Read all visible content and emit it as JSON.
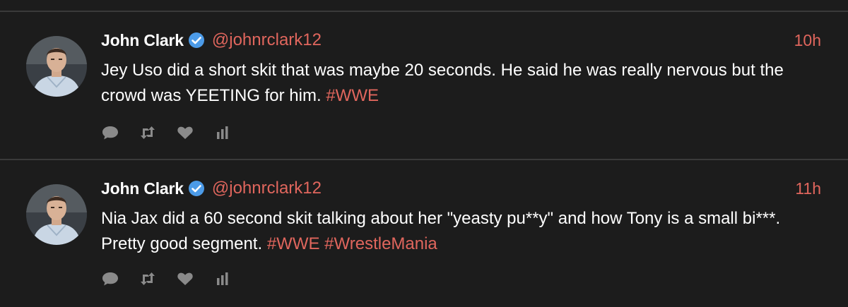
{
  "colors": {
    "background": "#1c1c1c",
    "accent": "#e0665d",
    "text": "#ffffff",
    "verified": "#4c9be8",
    "icons": "#8a8a8a"
  },
  "tweets": [
    {
      "name": "John Clark",
      "handle": "@johnrclark12",
      "time": "10h",
      "text": "Jey Uso did a short skit that was maybe 20 seconds. He said he was really nervous but the crowd was YEETING for him.",
      "hashtags": [
        "#WWE"
      ],
      "actions": [
        "reply-icon",
        "retweet-icon",
        "like-icon",
        "analytics-icon"
      ]
    },
    {
      "name": "John Clark",
      "handle": "@johnrclark12",
      "time": "11h",
      "text": "Nia Jax did a 60 second skit talking about her \"yeasty pu**y\" and how Tony is a small bi***. Pretty good segment.",
      "hashtags": [
        "#WWE",
        "#WrestleMania"
      ],
      "actions": [
        "reply-icon",
        "retweet-icon",
        "like-icon",
        "analytics-icon"
      ]
    }
  ]
}
